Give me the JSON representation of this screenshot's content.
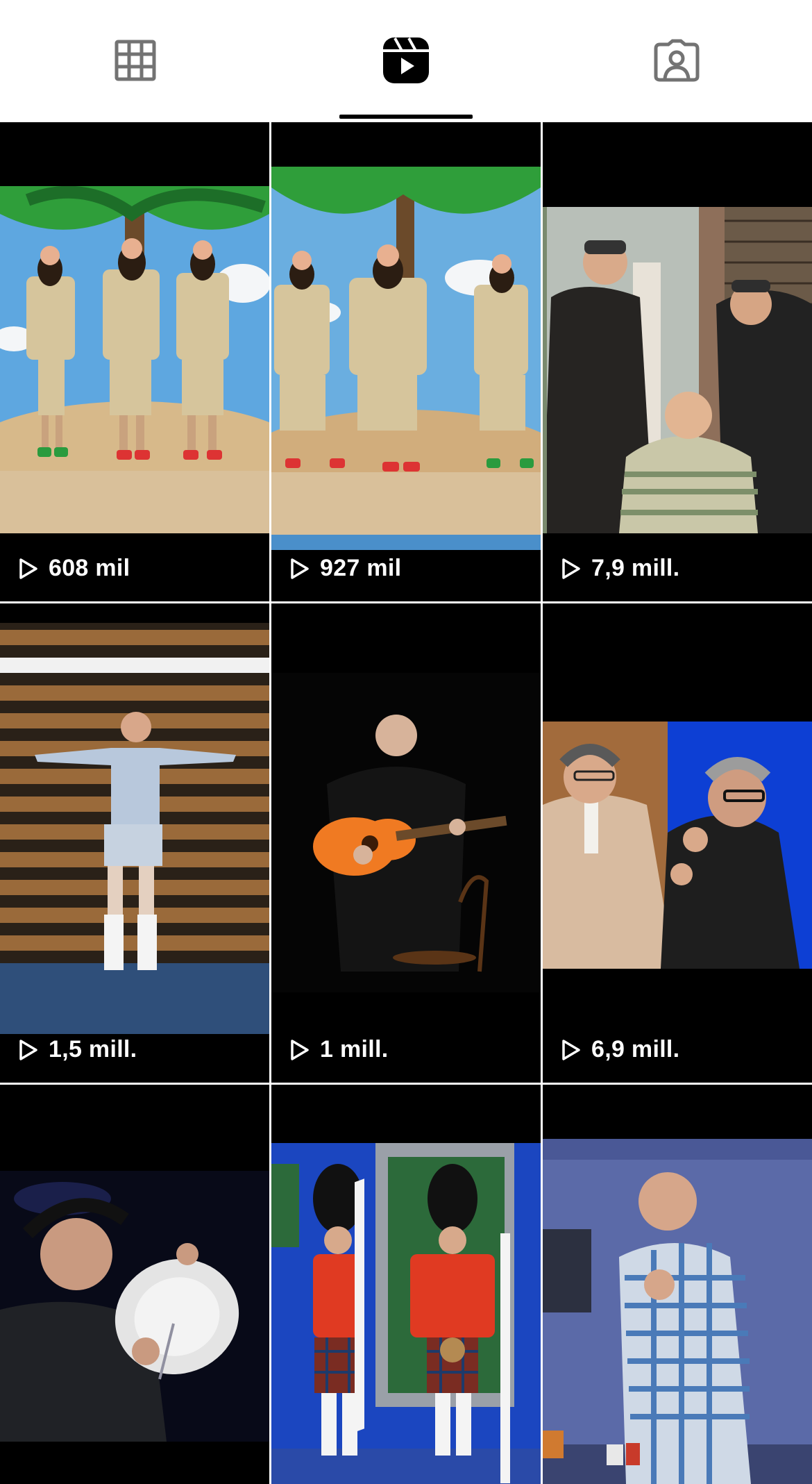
{
  "tabs": [
    {
      "name": "grid-tab",
      "icon": "grid-icon",
      "active": false
    },
    {
      "name": "reels-tab",
      "icon": "reels-icon",
      "active": true
    },
    {
      "name": "tagged-tab",
      "icon": "tagged-person-icon",
      "active": false
    }
  ],
  "reels": [
    {
      "views": "608 mil",
      "scene": "three bearded castaways on desert island"
    },
    {
      "views": "927 mil",
      "scene": "three bearded castaways on desert island"
    },
    {
      "views": "7,9 mill.",
      "scene": "men in leather coats and goggles, barber scene"
    },
    {
      "views": "1,5 mill.",
      "scene": "man in shorts on gym bleachers"
    },
    {
      "views": "1 mill.",
      "scene": "man playing guitar on dark stage"
    },
    {
      "views": "6,9 mill.",
      "scene": "two men in suits on blue stage"
    },
    {
      "views": "",
      "scene": "man holding plate in dark"
    },
    {
      "views": "",
      "scene": "two scottish guards on stage"
    },
    {
      "views": "",
      "scene": "man in plaid shirt on stage"
    }
  ],
  "colors": {
    "accent": "#000000",
    "icon_inactive": "#737373",
    "background": "#ffffff"
  }
}
